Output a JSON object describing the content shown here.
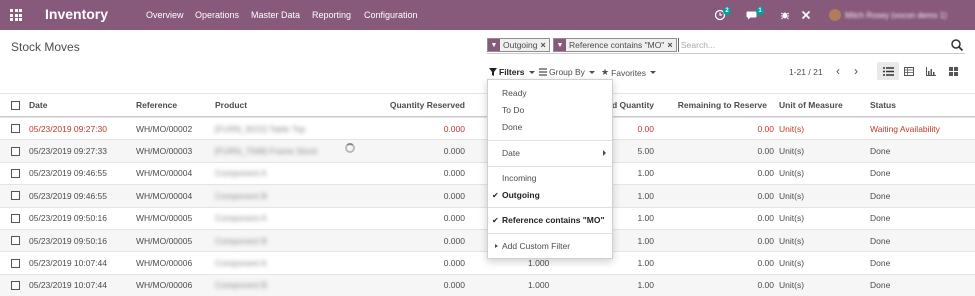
{
  "navbar": {
    "brand": "Inventory",
    "menu": [
      "Overview",
      "Operations",
      "Master Data",
      "Reporting",
      "Configuration"
    ],
    "activity_badge": "2",
    "messages_badge": "1",
    "user_name": "Mitch Rosey (vocon demo 1)"
  },
  "control": {
    "breadcrumb": "Stock Moves",
    "facets": [
      "Outgoing",
      "Reference contains \"MO\""
    ],
    "search_placeholder": "Search...",
    "filters_label": "Filters",
    "groupby_label": "Group By",
    "favorites_label": "Favorites",
    "pager": "1-21 / 21"
  },
  "table": {
    "headers": [
      "Date",
      "Reference",
      "Product",
      "Quantity Reserved",
      "d Quantity",
      "Remaining to Reserve",
      "Unit of Measure",
      "Status"
    ],
    "rows": [
      {
        "date": "05/23/2019 09:27:30",
        "ref": "WH/MO/00002",
        "product": "[FURN_8222] Table Top",
        "reserved": "0.000",
        "qty": "0.00",
        "remaining": "0.00",
        "uom": "Unit(s)",
        "status": "Waiting Availability",
        "late": true
      },
      {
        "date": "05/23/2019 09:27:33",
        "ref": "WH/MO/00003",
        "product": "[FURN_7598] Frame Stock",
        "reserved": "0.000",
        "qty": "5.00",
        "remaining": "0.00",
        "uom": "Unit(s)",
        "status": "Done",
        "late": false
      },
      {
        "date": "05/23/2019 09:46:55",
        "ref": "WH/MO/00004",
        "product": "Component A",
        "reserved": "0.000",
        "qty": "1.00",
        "remaining": "0.00",
        "uom": "Unit(s)",
        "status": "Done",
        "late": false
      },
      {
        "date": "05/23/2019 09:46:55",
        "ref": "WH/MO/00004",
        "product": "Component B",
        "reserved": "0.000",
        "qty": "1.00",
        "remaining": "0.00",
        "uom": "Unit(s)",
        "status": "Done",
        "late": false
      },
      {
        "date": "05/23/2019 09:50:16",
        "ref": "WH/MO/00005",
        "product": "Component A",
        "reserved": "0.000",
        "qty": "1.00",
        "remaining": "0.00",
        "uom": "Unit(s)",
        "status": "Done",
        "late": false
      },
      {
        "date": "05/23/2019 09:50:16",
        "ref": "WH/MO/00005",
        "product": "Component B",
        "reserved": "0.000",
        "qty": "1.00",
        "remaining": "0.00",
        "uom": "Unit(s)",
        "status": "Done",
        "late": false
      },
      {
        "date": "05/23/2019 10:07:44",
        "ref": "WH/MO/00006",
        "product": "Component A",
        "reserved": "0.000",
        "qty": "1.00",
        "remaining": "0.00",
        "uom": "Unit(s)",
        "status": "Done",
        "late": false,
        "mid": "1.000"
      },
      {
        "date": "05/23/2019 10:07:44",
        "ref": "WH/MO/00006",
        "product": "Component B",
        "reserved": "0.000",
        "qty": "1.00",
        "remaining": "0.00",
        "uom": "Unit(s)",
        "status": "Done",
        "late": false,
        "mid": "1.000"
      }
    ]
  },
  "dropdown": {
    "items": [
      "Ready",
      "To Do",
      "Done",
      "Date",
      "Incoming",
      "Outgoing",
      "Reference contains \"MO\"",
      "Add Custom Filter"
    ]
  },
  "colors": {
    "navbar": "#875a7b",
    "late": "#c0392b",
    "badge": "#00a09d"
  }
}
